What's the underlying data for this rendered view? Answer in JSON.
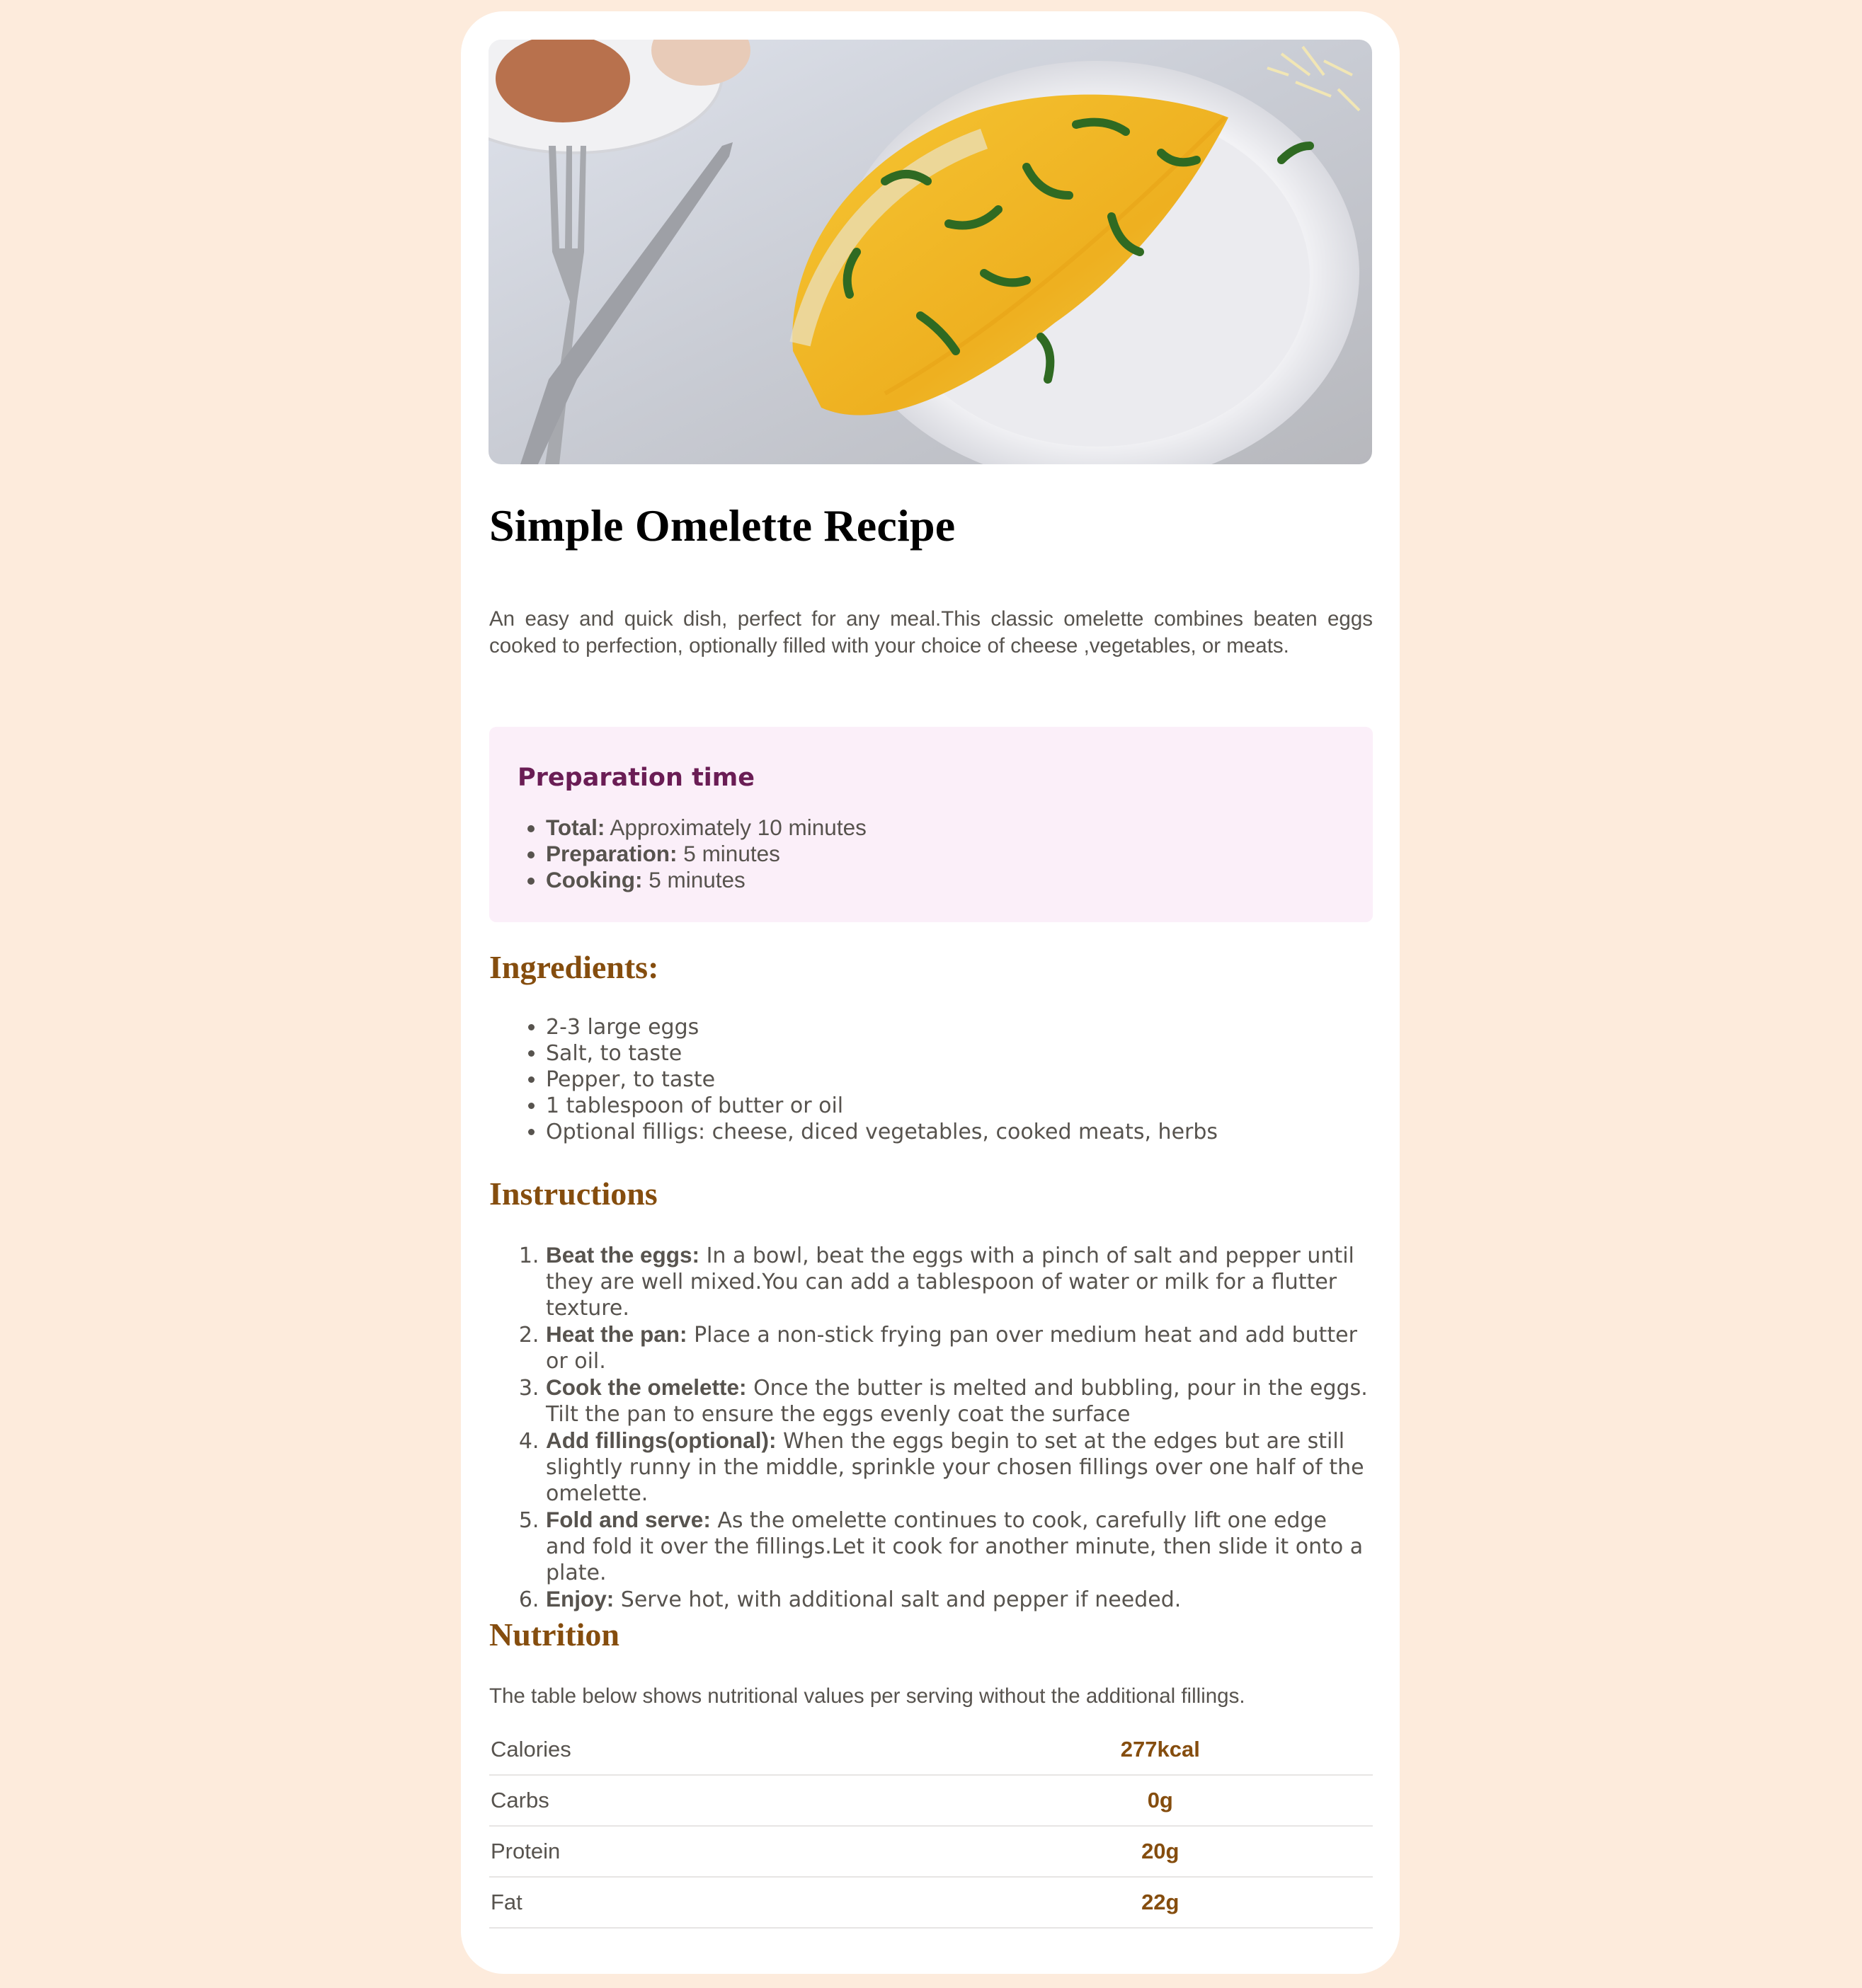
{
  "recipe": {
    "title": "Simple Omelette Recipe",
    "description": "An easy and quick dish, perfect for any meal.This classic omelette combines beaten eggs cooked to perfection, optionally filled with your choice of cheese ,vegetables, or meats."
  },
  "preparation": {
    "heading": "Preparation time",
    "items": [
      {
        "label": "Total:",
        "value": " Approximately 10 minutes"
      },
      {
        "label": "Preparation:",
        "value": " 5 minutes"
      },
      {
        "label": "Cooking:",
        "value": " 5 minutes"
      }
    ]
  },
  "ingredients": {
    "heading": "Ingredients:",
    "items": [
      "2-3 large eggs",
      "Salt, to taste",
      "Pepper, to taste",
      "1 tablespoon of butter or oil",
      "Optional filligs: cheese, diced vegetables, cooked meats, herbs"
    ]
  },
  "instructions": {
    "heading": "Instructions",
    "steps": [
      {
        "label": "Beat the eggs:",
        "text": " In a bowl, beat the eggs with a pinch of salt and pepper until they are well mixed.You can add a tablespoon of water or milk for a flutter texture."
      },
      {
        "label": "Heat the pan:",
        "text": " Place a non-stick frying pan over medium heat and add butter or oil."
      },
      {
        "label": "Cook the omelette:",
        "text": " Once the butter is melted and bubbling, pour in the eggs. Tilt the pan to ensure the eggs evenly coat the surface"
      },
      {
        "label": "Add fillings(optional):",
        "text": " When the eggs begin to set at the edges but are still slightly runny in the middle, sprinkle your chosen fillings over one half of the omelette."
      },
      {
        "label": "Fold and serve:",
        "text": " As the omelette continues to cook, carefully lift one edge and fold it over the fillings.Let it cook for another minute, then slide it onto a plate."
      },
      {
        "label": "Enjoy:",
        "text": " Serve hot, with additional salt and pepper if needed."
      }
    ]
  },
  "nutrition": {
    "heading": "Nutrition",
    "intro": "The table below shows nutritional values per serving without the additional fillings.",
    "rows": [
      {
        "label": "Calories",
        "value": "277kcal"
      },
      {
        "label": "Carbs",
        "value": "0g"
      },
      {
        "label": "Protein",
        "value": "20g"
      },
      {
        "label": "Fat",
        "value": "22g"
      }
    ]
  },
  "colors": {
    "page_bg": "#fdebdc",
    "card_bg": "#ffffff",
    "prep_bg": "#fbeff9",
    "prep_heading": "#6a1d55",
    "section_heading": "#854d0e",
    "body_text": "#57534e"
  }
}
